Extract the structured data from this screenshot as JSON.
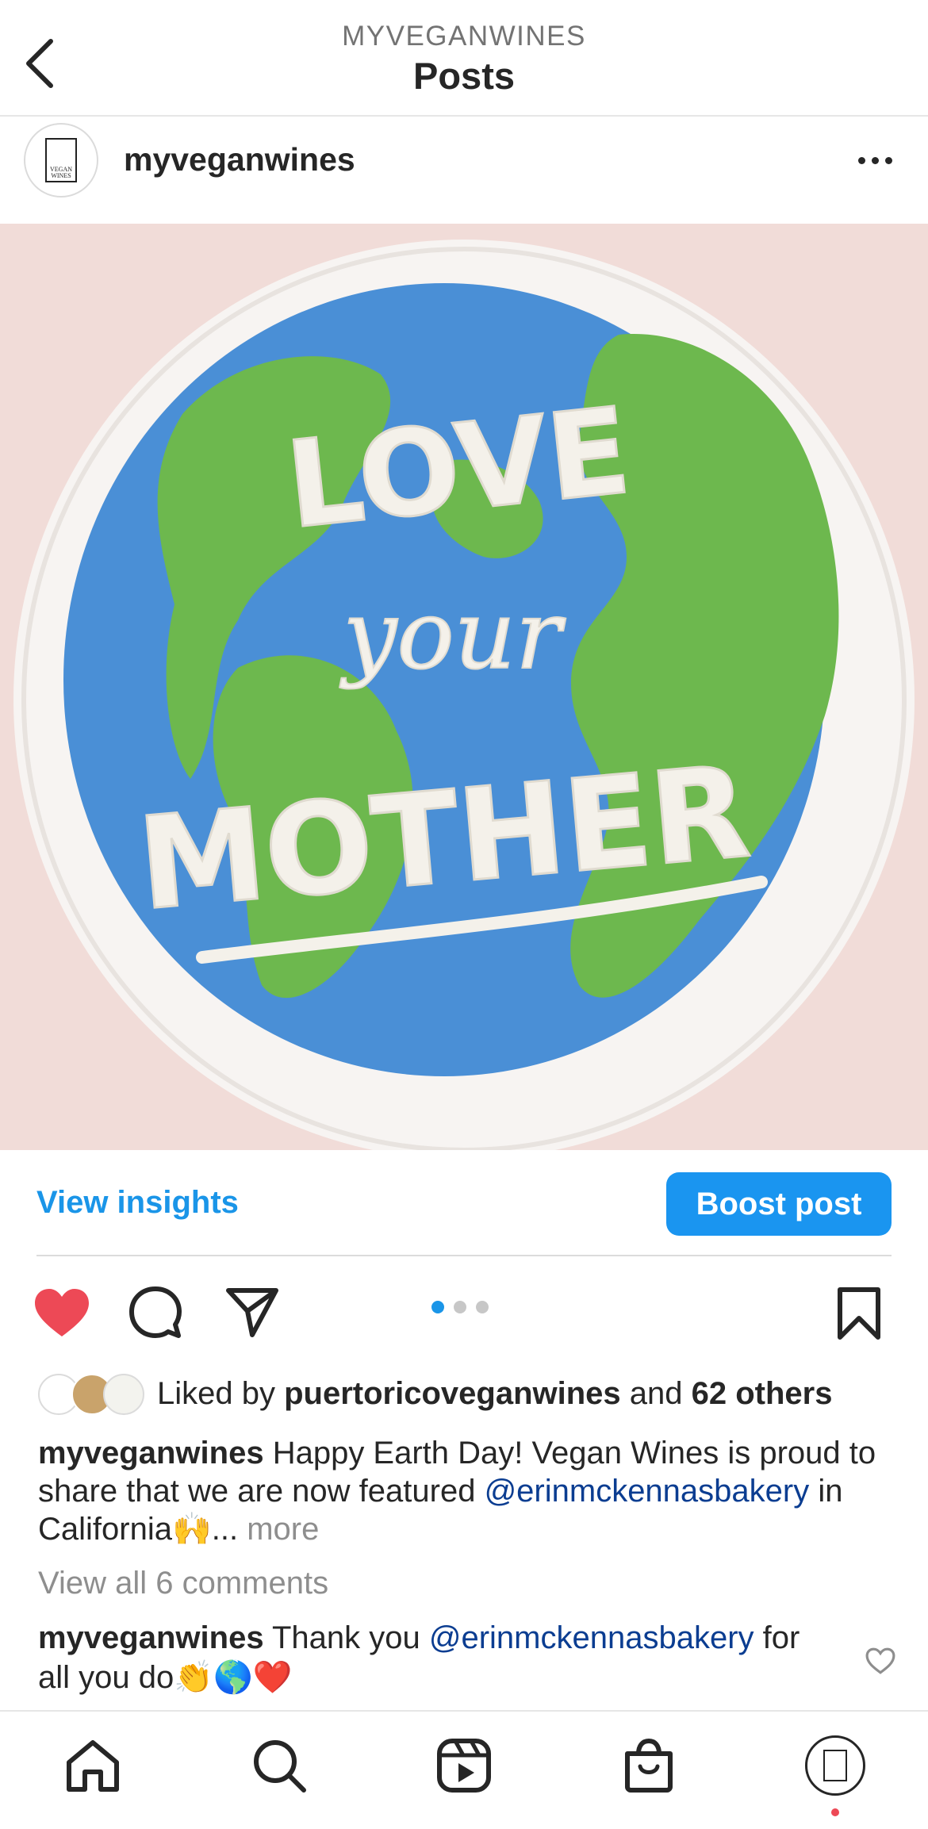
{
  "header": {
    "account": "MYVEGANWINES",
    "title": "Posts"
  },
  "post": {
    "username": "myveganwines",
    "avatar_text": [
      "VEGAN",
      "WINES"
    ],
    "image_text": [
      "LOVE",
      "your",
      "MOTHER"
    ],
    "view_insights": "View insights",
    "boost_label": "Boost post",
    "carousel": {
      "count": 3,
      "active_index": 0
    },
    "liked_prefix": "Liked by ",
    "liked_user": "puertoricoveganwines",
    "liked_and": " and ",
    "liked_others": "62 others",
    "caption": {
      "username": "myveganwines",
      "text_1": " Happy Earth Day! Vegan Wines is proud to share that we are now featured ",
      "mention": "@erinmckennasbakery",
      "text_2": " in California🙌... ",
      "more": "more"
    },
    "view_comments": "View all 6 comments",
    "comment": {
      "username": "myveganwines",
      "text_1": " Thank you ",
      "mention": "@erinmckennasbakery",
      "text_2": " for all you do👏🌎❤️"
    }
  },
  "colors": {
    "accent": "#1a95e8",
    "like_red": "#ed4956",
    "mention": "#0b3d91",
    "muted": "#8e8e8e"
  },
  "icons": [
    "back-icon",
    "more-icon",
    "heart-icon",
    "comment-icon",
    "share-icon",
    "bookmark-icon",
    "home-icon",
    "search-icon",
    "reels-icon",
    "shop-icon"
  ]
}
